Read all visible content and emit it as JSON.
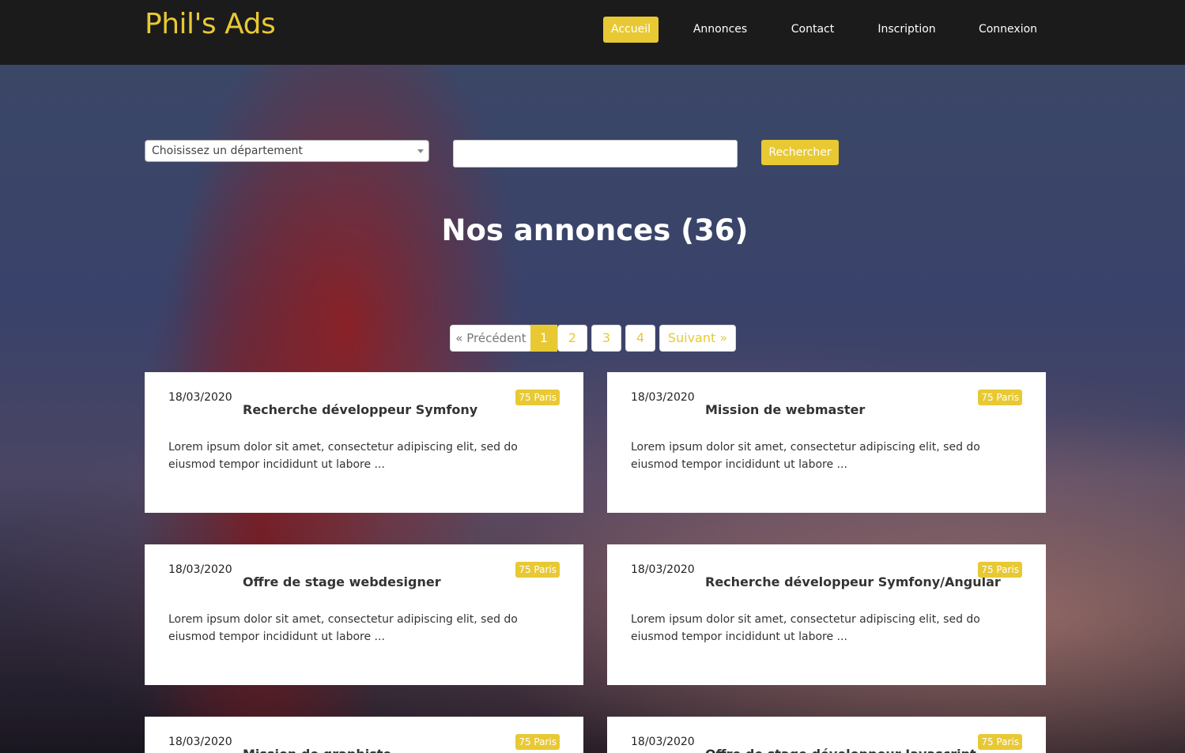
{
  "colors": {
    "accent": "#e8c934",
    "navbar_bg": "#1b1b1b",
    "card_bg": "#ffffff"
  },
  "header": {
    "brand": "Phil's Ads",
    "nav": [
      {
        "label": "Accueil",
        "active": true
      },
      {
        "label": "Annonces",
        "active": false
      },
      {
        "label": "Contact",
        "active": false
      },
      {
        "label": "Inscription",
        "active": false
      },
      {
        "label": "Connexion",
        "active": false
      }
    ]
  },
  "search": {
    "department_select_value": "Choisissez un département",
    "keyword_value": "",
    "button_label": "Rechercher"
  },
  "main": {
    "title": "Nos annonces (36)"
  },
  "pagination": {
    "prev_label": "« Précédent",
    "pages": [
      "1",
      "2",
      "3",
      "4"
    ],
    "current_page": "1",
    "next_label": "Suivant »"
  },
  "ads": [
    {
      "date": "18/03/2020",
      "title": "Recherche développeur Symfony",
      "location": "75 Paris",
      "excerpt": "Lorem ipsum dolor sit amet, consectetur adipiscing elit, sed do eiusmod tempor incididunt ut labore ..."
    },
    {
      "date": "18/03/2020",
      "title": "Mission de webmaster",
      "location": "75 Paris",
      "excerpt": "Lorem ipsum dolor sit amet, consectetur adipiscing elit, sed do eiusmod tempor incididunt ut labore ..."
    },
    {
      "date": "18/03/2020",
      "title": "Offre de stage webdesigner",
      "location": "75 Paris",
      "excerpt": "Lorem ipsum dolor sit amet, consectetur adipiscing elit, sed do eiusmod tempor incididunt ut labore ..."
    },
    {
      "date": "18/03/2020",
      "title": "Recherche développeur Symfony/Angular",
      "location": "75 Paris",
      "excerpt": "Lorem ipsum dolor sit amet, consectetur adipiscing elit, sed do eiusmod tempor incididunt ut labore ..."
    },
    {
      "date": "18/03/2020",
      "title": "Mission de graphiste",
      "location": "75 Paris",
      "excerpt": ""
    },
    {
      "date": "18/03/2020",
      "title": "Offre de stage développeur Javascript",
      "location": "75 Paris",
      "excerpt": ""
    }
  ]
}
